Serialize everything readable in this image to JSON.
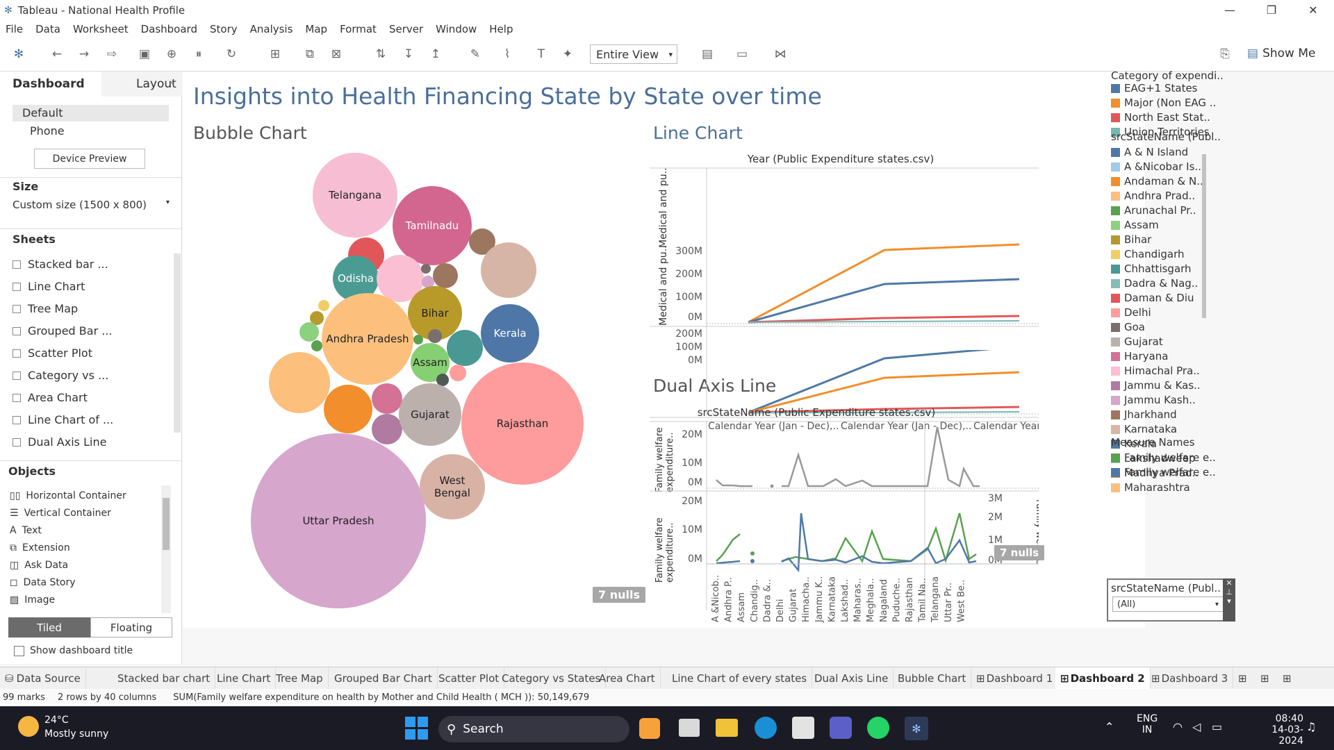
{
  "window": {
    "title": "Tableau - National Health Profile"
  },
  "menu": [
    "File",
    "Data",
    "Worksheet",
    "Dashboard",
    "Story",
    "Analysis",
    "Map",
    "Format",
    "Server",
    "Window",
    "Help"
  ],
  "toolbar": {
    "view_select": "Entire View",
    "show_me": "Show Me"
  },
  "left_pane": {
    "tabs": [
      "Dashboard",
      "Layout"
    ],
    "device_default": "Default",
    "device_phone": "Phone",
    "device_preview": "Device Preview",
    "size_label": "Size",
    "size_value": "Custom size (1500 x 800)",
    "sheets_label": "Sheets",
    "sheets": [
      "Stacked bar ...",
      "Line Chart",
      "Tree Map",
      "Grouped Bar ...",
      "Scatter Plot",
      "Category vs ...",
      "Area Chart",
      "Line Chart of ...",
      "Dual Axis Line"
    ],
    "objects_label": "Objects",
    "objects": [
      "Horizontal Container",
      "Vertical Container",
      "Text",
      "Extension",
      "Ask Data",
      "Data Story",
      "Image"
    ],
    "tiled": "Tiled",
    "floating": "Floating",
    "show_title": "Show dashboard title"
  },
  "dashboard": {
    "title": "Insights into Health Financing State by State over time",
    "bubble_title": "Bubble Chart",
    "line_title": "Line Chart",
    "dual_title": "Dual Axis Line",
    "nulls": "7 nulls",
    "bubbles": [
      {
        "label": "Telangana",
        "color": "#f7bdd3"
      },
      {
        "label": "Tamilnadu",
        "color": "#d2668e"
      },
      {
        "label": "Odisha",
        "color": "#4a9c93"
      },
      {
        "label": "Bihar",
        "color": "#b89a2a"
      },
      {
        "label": "Kerala",
        "color": "#4e77a7"
      },
      {
        "label": "Andhra Pradesh",
        "color": "#fcbf7c"
      },
      {
        "label": "Assam",
        "color": "#86cf72"
      },
      {
        "label": "Gujarat",
        "color": "#bbb0ac"
      },
      {
        "label": "Rajasthan",
        "color": "#fe9c9d"
      },
      {
        "label": "West Bengal",
        "color": "#d9b2a6"
      },
      {
        "label": "Uttar Pradesh",
        "color": "#d6a6cc"
      }
    ],
    "line_chart": {
      "header": "Year (Public Expenditure states.csv)",
      "yaxis1": "Medical and pu..",
      "yaxis2": "Medical and pu..",
      "ticks1": [
        "300M",
        "200M",
        "100M",
        "0M"
      ],
      "ticks2": [
        "200M",
        "100M",
        "0M"
      ],
      "xlabels": [
        "Calendar Year (Jan - Dec),..",
        "Calendar Year (Jan - Dec),..",
        "Calendar Year (Jan - Dec),.."
      ]
    },
    "dual_chart": {
      "header": "srcStateName (Public Expenditure states.csv)",
      "yaxis1": "Family welfare\nexpenditure..",
      "yaxis2": "Family welfare\nexpenditure..",
      "yaxis_right": "Family welfare...",
      "ticks1": [
        "20M",
        "10M",
        "0M"
      ],
      "ticks2": [
        "20M",
        "10M",
        "0M"
      ],
      "ticks_right": [
        "3M",
        "2M",
        "1M",
        "0M"
      ],
      "xlabels": [
        "A &Nicob..",
        "Andhra P..",
        "Assam",
        "Chandig..",
        "Dadra &..",
        "Delhi",
        "Gujarat",
        "Himacha..",
        "Jammu K..",
        "Karnataka",
        "Lakshad..",
        "Maharas..",
        "Meghala..",
        "Nagaland",
        "Puduche..",
        "Rajasthan",
        "Tamil Na..",
        "Telangana",
        "Uttar Pr..",
        "West Be.."
      ]
    },
    "legend_category": {
      "title": "Category of expendi..",
      "items": [
        {
          "label": "EAG+1 States",
          "color": "#4e79a7"
        },
        {
          "label": "Major (Non EAG ..",
          "color": "#f28e2b"
        },
        {
          "label": "North East Stat..",
          "color": "#e15759"
        },
        {
          "label": "Union Territories",
          "color": "#76b7b2"
        }
      ]
    },
    "legend_state": {
      "title": "srcStateName (Publ..",
      "items": [
        {
          "label": "A & N Island",
          "color": "#4e79a7"
        },
        {
          "label": "A &Nicobar Is..",
          "color": "#a0cbe8"
        },
        {
          "label": "Andaman & N..",
          "color": "#f28e2b"
        },
        {
          "label": "Andhra Prad..",
          "color": "#ffbe7d"
        },
        {
          "label": "Arunachal Pr..",
          "color": "#59a14f"
        },
        {
          "label": "Assam",
          "color": "#8cd17d"
        },
        {
          "label": "Bihar",
          "color": "#b6992d"
        },
        {
          "label": "Chandigarh",
          "color": "#f1ce63"
        },
        {
          "label": "Chhattisgarh",
          "color": "#499894"
        },
        {
          "label": "Dadra & Nag..",
          "color": "#86bcb6"
        },
        {
          "label": "Daman & Diu",
          "color": "#e15759"
        },
        {
          "label": "Delhi",
          "color": "#ff9d9a"
        },
        {
          "label": "Goa",
          "color": "#79706e"
        },
        {
          "label": "Gujarat",
          "color": "#bab0ac"
        },
        {
          "label": "Haryana",
          "color": "#d37295"
        },
        {
          "label": "Himachal Pra..",
          "color": "#fabfd2"
        },
        {
          "label": "Jammu & Kas..",
          "color": "#b07aa1"
        },
        {
          "label": "Jammu Kash..",
          "color": "#d4a6c8"
        },
        {
          "label": "Jharkhand",
          "color": "#9d7660"
        },
        {
          "label": "Karnataka",
          "color": "#d7b5a6"
        },
        {
          "label": "Kerala",
          "color": "#4e79a7"
        },
        {
          "label": "Lakshadweep",
          "color": "#a0cbe8"
        },
        {
          "label": "Madhya Prad..",
          "color": "#f28e2b"
        },
        {
          "label": "Maharashtra",
          "color": "#ffbe7d"
        }
      ]
    },
    "legend_measure": {
      "title": "Measure Names",
      "items": [
        {
          "label": "Family welfare e..",
          "color": "#59a14f"
        },
        {
          "label": "Family welfare e..",
          "color": "#4e79a7"
        }
      ]
    },
    "filter": {
      "title": "srcStateName (Publ..",
      "value": "(All)"
    }
  },
  "tabs": [
    "Data Source",
    "Stacked bar chart",
    "Line Chart",
    "Tree Map",
    "Grouped Bar Chart",
    "Scatter Plot",
    "Category vs States",
    "Area Chart",
    "Line Chart of every states",
    "Dual Axis Line",
    "Bubble Chart",
    "Dashboard 1",
    "Dashboard 2",
    "Dashboard 3"
  ],
  "status": {
    "marks": "99 marks",
    "rows": "2 rows by 40 columns",
    "sum": "SUM(Family welfare expenditure on health by Mother and Child Health ( MCH )): 50,149,679"
  },
  "taskbar": {
    "temp": "24°C",
    "weather": "Mostly sunny",
    "search": "Search",
    "lang1": "ENG",
    "lang2": "IN",
    "time": "08:40",
    "date": "14-03-2024"
  }
}
